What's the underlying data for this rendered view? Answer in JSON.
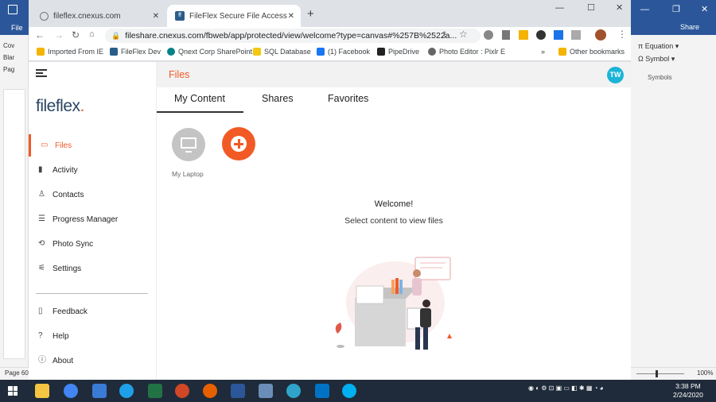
{
  "word": {
    "file_tab": "File",
    "share": "Share",
    "equation": "Equation",
    "symbol": "Symbol",
    "symbols_group": "Symbols",
    "left_items": [
      "Cov",
      "Blar",
      "Pag"
    ],
    "page_status": "Page 60",
    "zoom": "100%"
  },
  "browser": {
    "tabs": [
      {
        "title": "fileflex.cnexus.com"
      },
      {
        "title": "FileFlex Secure File Access"
      }
    ],
    "url": "fileshare.cnexus.com/fbweb/app/protected/view/welcome?type=canvas#%257B%2522a...",
    "bookmarks": [
      {
        "label": "Imported From IE",
        "icon": "folder-icon",
        "color": "#f4b400"
      },
      {
        "label": "FileFlex Dev",
        "icon": "fileflex-icon",
        "color": "#2b5d8a"
      },
      {
        "label": "Qnext Corp SharePoint...",
        "icon": "sharepoint-icon",
        "color": "#038387"
      },
      {
        "label": "SQL Database",
        "icon": "sql-icon",
        "color": "#f2c811"
      },
      {
        "label": "(1) Facebook",
        "icon": "facebook-icon",
        "color": "#1877f2"
      },
      {
        "label": "PipeDrive",
        "icon": "pipedrive-icon",
        "color": "#222222"
      },
      {
        "label": "Photo Editor : Pixlr E",
        "icon": "pixlr-icon",
        "color": "#666666"
      }
    ],
    "more_bookmarks": "»",
    "other_bookmarks": "Other bookmarks"
  },
  "app": {
    "logo_text": "fileflex",
    "header_title": "Files",
    "avatar_initials": "TW",
    "nav_top": [
      {
        "label": "Files",
        "icon": "folder-icon",
        "active": true
      },
      {
        "label": "Activity",
        "icon": "bar-chart-icon",
        "active": false
      },
      {
        "label": "Contacts",
        "icon": "contacts-icon",
        "active": false
      },
      {
        "label": "Progress Manager",
        "icon": "progress-icon",
        "active": false
      },
      {
        "label": "Photo Sync",
        "icon": "sync-icon",
        "active": false
      },
      {
        "label": "Settings",
        "icon": "settings-icon",
        "active": false
      }
    ],
    "nav_bottom": [
      {
        "label": "Feedback",
        "icon": "feedback-icon"
      },
      {
        "label": "Help",
        "icon": "help-icon"
      },
      {
        "label": "About",
        "icon": "info-icon"
      }
    ],
    "content_tabs": [
      {
        "label": "My Content",
        "active": true
      },
      {
        "label": "Shares",
        "active": false
      },
      {
        "label": "Favorites",
        "active": false
      }
    ],
    "sources": [
      {
        "label": "My Laptop",
        "icon": "laptop-icon"
      }
    ],
    "add_button_icon": "plus-icon",
    "welcome_title": "Welcome!",
    "welcome_subtitle": "Select content to view files",
    "accent_color": "#f15a24",
    "avatar_color": "#1bb4d8"
  },
  "taskbar": {
    "time": "3:38 PM",
    "date": "2/24/2020",
    "apps": [
      "file-explorer-icon",
      "chrome-icon",
      "store-icon",
      "ie-icon",
      "excel-icon",
      "powerpoint-icon",
      "firefox-icon",
      "word-icon",
      "photos-icon",
      "edge-icon",
      "outlook-icon",
      "skype-icon"
    ]
  }
}
